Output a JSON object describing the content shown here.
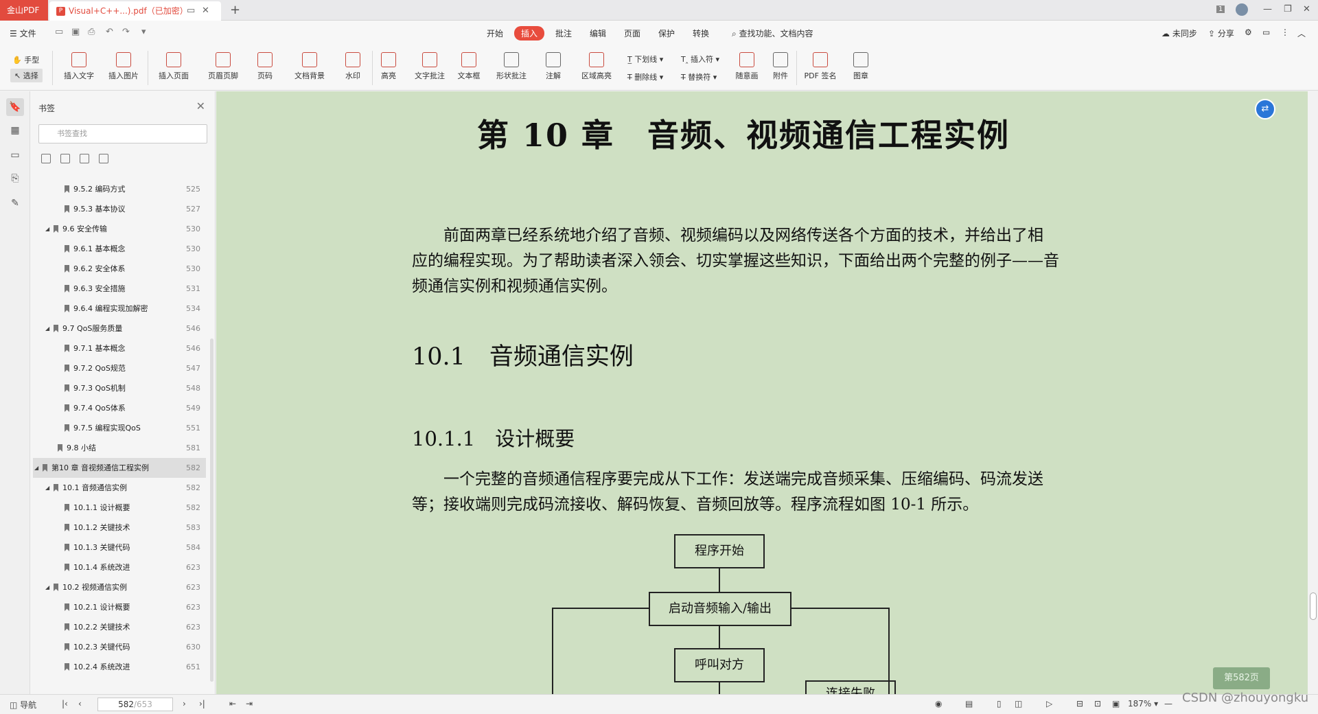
{
  "titlebar": {
    "app_tab": "金山PDF",
    "doc_tab": "Visual+C++...).pdf（已加密）",
    "doc_tab_icon": "pdf-icon",
    "new_tab": "+",
    "badge": "1"
  },
  "menubar": {
    "file": "☰ 文件",
    "tabs": [
      "开始",
      "插入",
      "批注",
      "编辑",
      "页面",
      "保护",
      "转换"
    ],
    "active_tab": "插入",
    "search": "查找功能、文档内容",
    "sync": "未同步",
    "share": "分享"
  },
  "ribbon": {
    "hand": "手型",
    "select": "选择",
    "buttons": [
      "插入文字",
      "插入图片",
      "插入页面",
      "页眉页脚",
      "页码",
      "文档背景",
      "水印",
      "高亮",
      "文字批注",
      "文本框",
      "形状批注",
      "注解",
      "区域高亮"
    ],
    "underline": "下划线",
    "strike": "删除线",
    "insert_mark": "插入符",
    "replace_mark": "替换符",
    "freehand": "随意画",
    "attach": "附件",
    "pdf_sign": "PDF 签名",
    "stamp": "图章"
  },
  "sidebar": {
    "title": "书签",
    "search_placeholder": "书签查找",
    "items": [
      {
        "label": "9.5.2 编码方式",
        "page": "525",
        "level": 3
      },
      {
        "label": "9.5.3 基本协议",
        "page": "527",
        "level": 3
      },
      {
        "label": "9.6 安全传输",
        "page": "530",
        "level": 2
      },
      {
        "label": "9.6.1 基本概念",
        "page": "530",
        "level": 3
      },
      {
        "label": "9.6.2 安全体系",
        "page": "530",
        "level": 3
      },
      {
        "label": "9.6.3 安全措施",
        "page": "531",
        "level": 3
      },
      {
        "label": "9.6.4 编程实现加解密",
        "page": "534",
        "level": 3
      },
      {
        "label": "9.7 QoS服务质量",
        "page": "546",
        "level": 2
      },
      {
        "label": "9.7.1 基本概念",
        "page": "546",
        "level": 3
      },
      {
        "label": "9.7.2 QoS规范",
        "page": "547",
        "level": 3
      },
      {
        "label": "9.7.3 QoS机制",
        "page": "548",
        "level": 3
      },
      {
        "label": "9.7.4 QoS体系",
        "page": "549",
        "level": 3
      },
      {
        "label": "9.7.5 编程实现QoS",
        "page": "551",
        "level": 3
      },
      {
        "label": "9.8 小结",
        "page": "581",
        "level": 1
      },
      {
        "label": "第10 章 音视频通信工程实例",
        "page": "582",
        "level": 0
      },
      {
        "label": "10.1 音频通信实例",
        "page": "582",
        "level": 2
      },
      {
        "label": "10.1.1 设计概要",
        "page": "582",
        "level": 3
      },
      {
        "label": "10.1.2 关键技术",
        "page": "583",
        "level": 3
      },
      {
        "label": "10.1.3 关键代码",
        "page": "584",
        "level": 3
      },
      {
        "label": "10.1.4 系统改进",
        "page": "623",
        "level": 3
      },
      {
        "label": "10.2 视频通信实例",
        "page": "623",
        "level": 2
      },
      {
        "label": "10.2.1 设计概要",
        "page": "623",
        "level": 3
      },
      {
        "label": "10.2.2 关键技术",
        "page": "623",
        "level": 3
      },
      {
        "label": "10.2.3 关键代码",
        "page": "630",
        "level": 3
      },
      {
        "label": "10.2.4 系统改进",
        "page": "651",
        "level": 3
      }
    ]
  },
  "document": {
    "chapter_title": "第 10 章　音频、视频通信工程实例",
    "para1": [
      "　　前面两章已经系统地介绍了音频、视频编码以及网络传送各个方面的技术，并给出了相",
      "应的编程实现。为了帮助读者深入领会、切实掌握这些知识，下面给出两个完整的例子——音",
      "频通信实例和视频通信实例。"
    ],
    "sec_101": "10.1　音频通信实例",
    "sec_1011": "10.1.1　设计概要",
    "para2": [
      "　　一个完整的音频通信程序要完成从下工作：发送端完成音频采集、压缩编码、码流发送",
      "等；接收端则完成码流接收、解码恢复、音频回放等。程序流程如图 10-1 所示。"
    ],
    "flow": {
      "start": "程序开始",
      "io": "启动音频输入/输出",
      "call": "呼叫对方",
      "fail": "连接失败"
    },
    "page_badge": "第582页"
  },
  "statusbar": {
    "nav": "导航",
    "current_page": "582",
    "total_pages": "/653",
    "zoom": "187%",
    "watermark": "CSDN @zhouyongku"
  }
}
